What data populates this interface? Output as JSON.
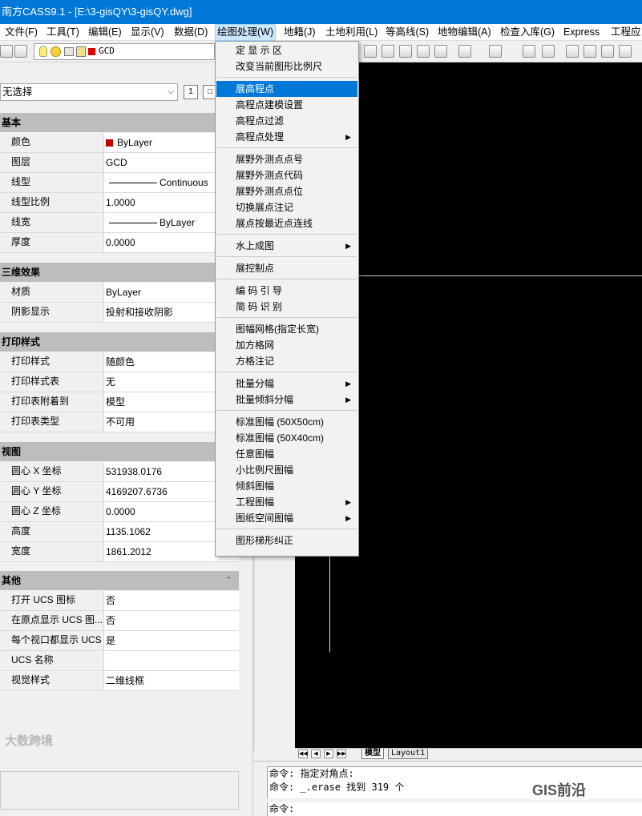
{
  "window": {
    "title": "南方CASS9.1 - [E:\\3-gisQY\\3-gisQY.dwg]"
  },
  "menubar": {
    "items": [
      {
        "label": "文件(F)"
      },
      {
        "label": "工具(T)"
      },
      {
        "label": "编辑(E)"
      },
      {
        "label": "显示(V)"
      },
      {
        "label": "数据(D)"
      },
      {
        "label": "绘图处理(W)"
      },
      {
        "label": "地籍(J)"
      },
      {
        "label": "土地利用(L)"
      },
      {
        "label": "等高线(S)"
      },
      {
        "label": "地物编辑(A)"
      },
      {
        "label": "检查入库(G)"
      },
      {
        "label": "Express"
      },
      {
        "label": "工程应"
      }
    ],
    "active_index": 5
  },
  "toolbar": {
    "current_layer": "GCD",
    "layer_color": "#e00000"
  },
  "properties": {
    "selection": "无选择",
    "sections": {
      "basic": "基本",
      "three_d": "三维效果",
      "plot": "打印样式",
      "view": "视图",
      "other": "其他"
    },
    "basic": [
      {
        "key": "颜色",
        "value": "ByLayer"
      },
      {
        "key": "图层",
        "value": "GCD"
      },
      {
        "key": "线型",
        "value": "Continuous"
      },
      {
        "key": "线型比例",
        "value": "1.0000"
      },
      {
        "key": "线宽",
        "value": "ByLayer"
      },
      {
        "key": "厚度",
        "value": "0.0000"
      }
    ],
    "three_d": [
      {
        "key": "材质",
        "value": "ByLayer"
      },
      {
        "key": "阴影显示",
        "value": "投射和接收阴影"
      }
    ],
    "plot": [
      {
        "key": "打印样式",
        "value": "随颜色"
      },
      {
        "key": "打印样式表",
        "value": "无"
      },
      {
        "key": "打印表附着到",
        "value": "模型"
      },
      {
        "key": "打印表类型",
        "value": "不可用"
      }
    ],
    "view": [
      {
        "key": "圆心 X 坐标",
        "value": "531938.0176"
      },
      {
        "key": "圆心 Y 坐标",
        "value": "4169207.6736"
      },
      {
        "key": "圆心 Z 坐标",
        "value": "0.0000"
      },
      {
        "key": "高度",
        "value": "1135.1062"
      },
      {
        "key": "宽度",
        "value": "1861.2012"
      }
    ],
    "other": [
      {
        "key": "打开 UCS 图标",
        "value": "否"
      },
      {
        "key": "在原点显示 UCS 图...",
        "value": "否"
      },
      {
        "key": "每个视口都显示 UCS",
        "value": "是"
      },
      {
        "key": "UCS 名称",
        "value": ""
      },
      {
        "key": "视觉样式",
        "value": "二维线框"
      }
    ]
  },
  "menu": {
    "groups": [
      [
        "定 显 示 区",
        "改变当前图形比例尺"
      ],
      [
        "展高程点",
        "高程点建模设置",
        "高程点过滤",
        "高程点处理"
      ],
      [
        "展野外测点点号",
        "展野外测点代码",
        "展野外测点点位",
        "切换展点注记",
        "展点按最近点连线"
      ],
      [
        "水上成图"
      ],
      [
        "展控制点"
      ],
      [
        "编 码 引 导",
        "简 码 识 别"
      ],
      [
        "图幅网格(指定长宽)",
        "加方格网",
        "方格注记"
      ],
      [
        "批量分幅",
        "批量倾斜分幅"
      ],
      [
        "标准图幅 (50X50cm)",
        "标准图幅 (50X40cm)",
        "任意图幅",
        "小比例尺图幅",
        "倾斜图幅",
        "工程图幅",
        "图纸空间图幅"
      ],
      [
        "图形梯形纠正"
      ]
    ],
    "highlighted": "展高程点",
    "submenu_items": [
      "高程点处理",
      "水上成图",
      "批量分幅",
      "批量倾斜分幅",
      "工程图幅",
      "图纸空间图幅"
    ]
  },
  "layout_tabs": [
    "模型",
    "Layout1"
  ],
  "command": {
    "history": [
      "命令: 指定对角点:",
      "命令: _.erase 找到 319 个"
    ],
    "prompt": "命令:"
  },
  "watermarks": {
    "left": "大数跨境",
    "right": "GIS前沿"
  }
}
